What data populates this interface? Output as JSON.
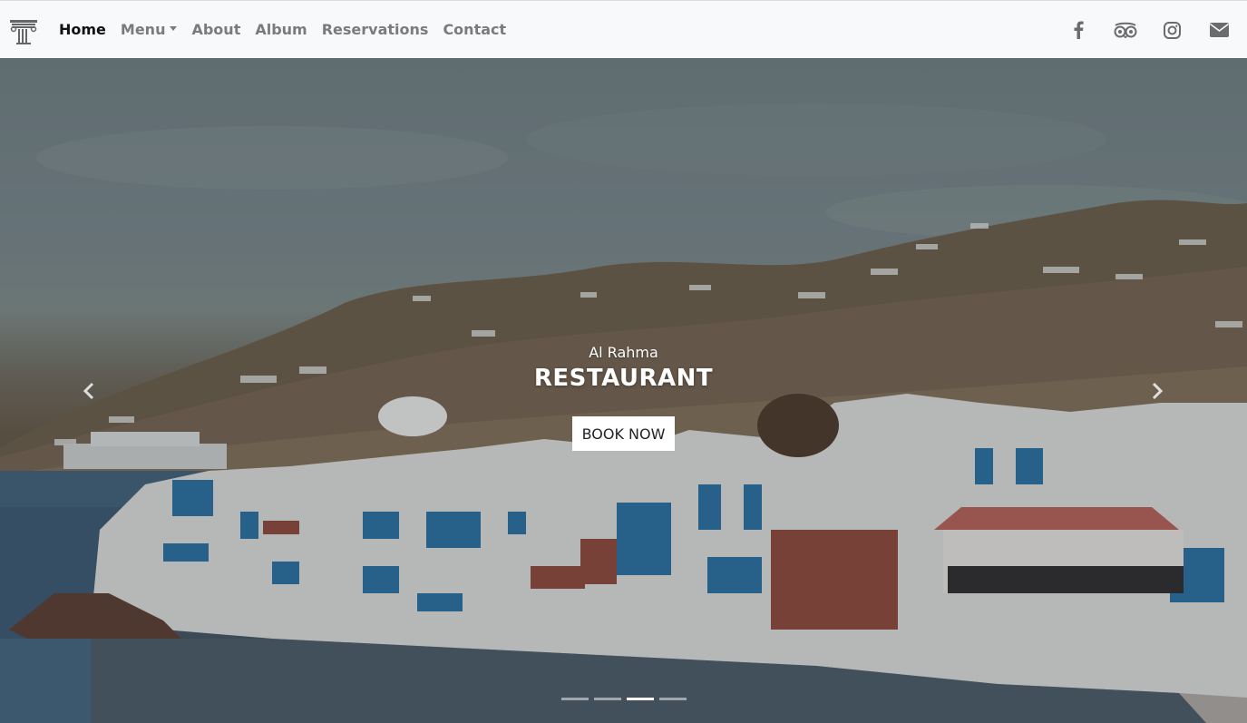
{
  "navbar": {
    "brand_icon": "column-pillar-icon",
    "links": [
      {
        "label": "Home",
        "active": true
      },
      {
        "label": "Menu",
        "dropdown": true
      },
      {
        "label": "About"
      },
      {
        "label": "Album"
      },
      {
        "label": "Reservations"
      },
      {
        "label": "Contact"
      }
    ],
    "social_icons": [
      "facebook-icon",
      "tripadvisor-icon",
      "instagram-icon",
      "envelope-icon"
    ],
    "active_color": "#111111",
    "link_color": "#7b7b7b",
    "background": "#f8f9fa"
  },
  "hero": {
    "subtitle": "Al Rahma",
    "title": "RESTAURANT",
    "cta_label": "BOOK NOW",
    "image_subject": "coastal-village-photo",
    "slides_count": 4,
    "active_slide": 3
  }
}
